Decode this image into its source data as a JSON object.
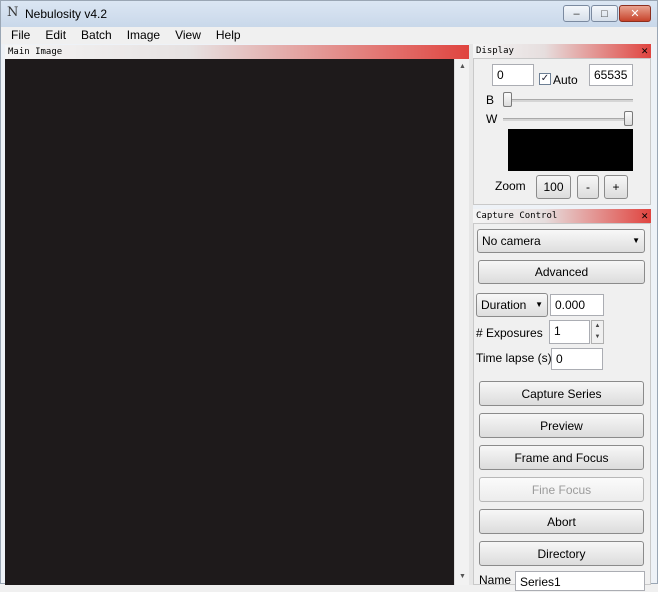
{
  "window": {
    "title": "Nebulosity v4.2",
    "logo_glyph": "N",
    "controls": {
      "minimize": "‒",
      "maximize": "□",
      "close": "✕"
    }
  },
  "menubar": {
    "items": [
      {
        "label": "File"
      },
      {
        "label": "Edit"
      },
      {
        "label": "Batch"
      },
      {
        "label": "Image"
      },
      {
        "label": "View"
      },
      {
        "label": "Help"
      }
    ]
  },
  "main_image": {
    "header": "Main Image",
    "scroll_up": "▲",
    "scroll_down": "▼"
  },
  "display_panel": {
    "header": "Display",
    "close": "✕",
    "black_value": "0",
    "auto_label": "Auto",
    "auto_checked": true,
    "check_glyph": "✓",
    "white_value": "65535",
    "b_label": "B",
    "w_label": "W",
    "black_slider_level": 0.0,
    "white_slider_level": 1.0,
    "zoom_label": "Zoom",
    "zoom_value": "100",
    "zoom_minus": "-",
    "zoom_plus": "+"
  },
  "capture_panel": {
    "header": "Capture Control",
    "close": "✕",
    "camera_select": "No camera",
    "caret": "▼",
    "advanced_button": "Advanced",
    "duration_select": "Duration",
    "duration_value": "0.000",
    "exposures_label": "# Exposures",
    "exposures_value": "1",
    "spin_up": "▲",
    "spin_down": "▼",
    "timelapse_label": "Time lapse (s)",
    "timelapse_value": "0",
    "buttons": {
      "capture_series": "Capture Series",
      "preview": "Preview",
      "frame_focus": "Frame and Focus",
      "fine_focus": "Fine Focus",
      "abort": "Abort",
      "directory": "Directory"
    },
    "name_label": "Name",
    "name_value": "Series1"
  }
}
